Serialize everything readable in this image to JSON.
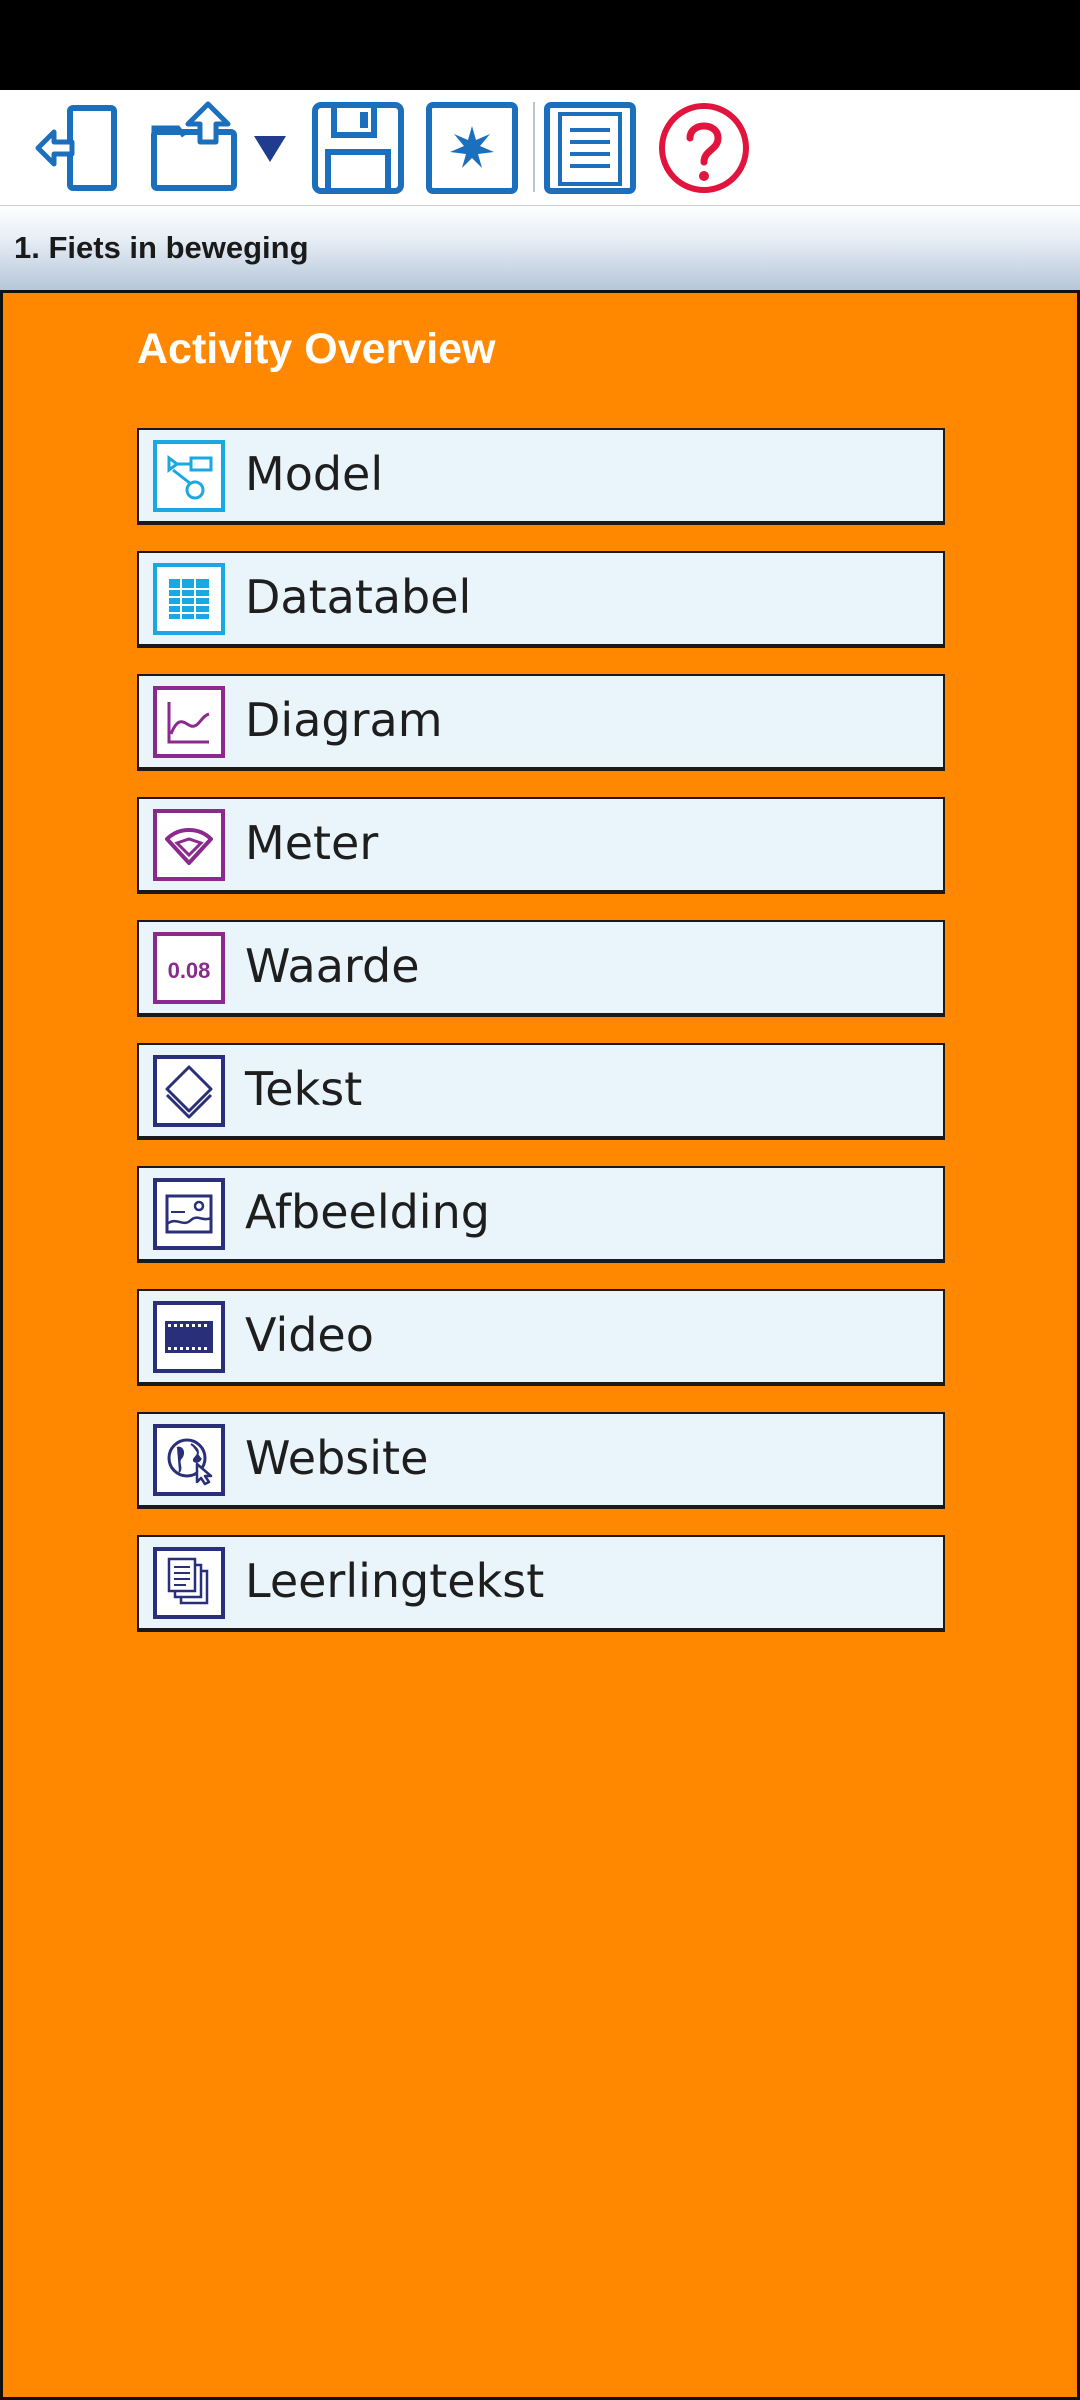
{
  "activity_title": "1. Fiets in beweging",
  "panel_title": "Activity Overview",
  "toolbar": [
    {
      "name": "exit-icon",
      "color": "#1c6fbd"
    },
    {
      "name": "export-icon",
      "color": "#1c6fbd"
    },
    {
      "name": "dropdown-arrow-icon",
      "color": "#1f3c8f"
    },
    {
      "name": "save-icon",
      "color": "#1c6fbd"
    },
    {
      "name": "new-icon",
      "color": "#1c6fbd"
    },
    {
      "name": "notes-icon",
      "color": "#1c6fbd"
    },
    {
      "name": "help-icon",
      "color": "#e0143c"
    }
  ],
  "items": [
    {
      "label": "Model",
      "icon": "model-icon",
      "color": "#1aa8e0"
    },
    {
      "label": "Datatabel",
      "icon": "table-icon",
      "color": "#1aa8e0"
    },
    {
      "label": "Diagram",
      "icon": "graph-icon",
      "color": "#8b2a8e"
    },
    {
      "label": "Meter",
      "icon": "gauge-icon",
      "color": "#8b2a8e"
    },
    {
      "label": "Waarde",
      "icon": "value-icon",
      "color": "#8b2a8e",
      "icon_text": "0.08"
    },
    {
      "label": "Tekst",
      "icon": "text-icon",
      "color": "#2a2f7a"
    },
    {
      "label": "Afbeelding",
      "icon": "image-icon",
      "color": "#2a2f7a"
    },
    {
      "label": "Video",
      "icon": "video-icon",
      "color": "#2a2f7a"
    },
    {
      "label": "Website",
      "icon": "website-icon",
      "color": "#2a2f7a"
    },
    {
      "label": "Leerlingtekst",
      "icon": "student-text-icon",
      "color": "#2a2f7a"
    }
  ],
  "colors": {
    "panel_background": "#ff8800",
    "item_background": "#eaf4fb"
  }
}
